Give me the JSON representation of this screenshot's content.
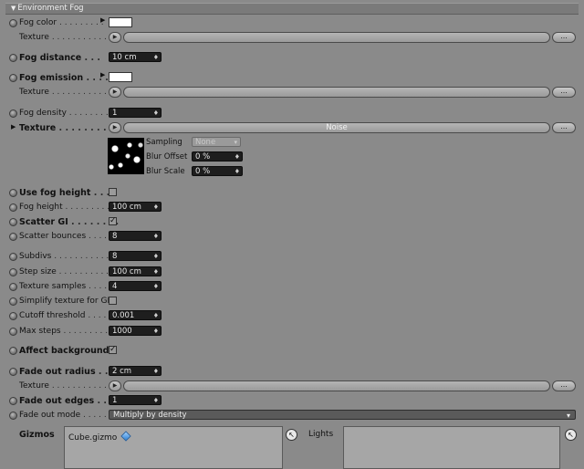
{
  "section": {
    "title": "Environment Fog"
  },
  "rows": {
    "fog_color": {
      "label": "Fog color",
      "dots": " . . . . . . . . ."
    },
    "texture1": {
      "label": "Texture",
      "dots": " . . . . . . . . . . . ."
    },
    "fog_distance": {
      "label": "Fog distance",
      "dots": " . . .",
      "value": "10 cm"
    },
    "fog_emission": {
      "label": "Fog emission",
      "dots": " . . . ."
    },
    "texture2": {
      "label": "Texture",
      "dots": " . . . . . . . . . . . ."
    },
    "fog_density": {
      "label": "Fog density",
      "dots": " . . . . . . . . .",
      "value": "1"
    },
    "texture3": {
      "label": "Texture",
      "dots": " . . . . . . . . .",
      "field": "Noise"
    },
    "use_fog_height": {
      "label": "Use fog height",
      "dots": " . . ."
    },
    "fog_height": {
      "label": "Fog height",
      "dots": " . . . . . . . . .",
      "value": "100 cm"
    },
    "scatter_gi": {
      "label": "Scatter GI",
      "dots": " . . . . . . . ."
    },
    "scatter_bounces": {
      "label": "Scatter bounces",
      "dots": " . . . . .",
      "value": "8"
    },
    "subdivs": {
      "label": "Subdivs",
      "dots": " . . . . . . . . . . . . .",
      "value": "8"
    },
    "step_size": {
      "label": "Step size",
      "dots": " . . . . . . . . . . .",
      "value": "100 cm"
    },
    "texture_samples": {
      "label": "Texture samples",
      "dots": " . . . .",
      "value": "4"
    },
    "simplify_texture": {
      "label": "Simplify texture for GI",
      "dots": ""
    },
    "cutoff_threshold": {
      "label": "Cutoff threshold",
      "dots": " . . . .",
      "value": "0.001"
    },
    "max_steps": {
      "label": "Max steps",
      "dots": " . . . . . . . . . .",
      "value": "1000"
    },
    "affect_background": {
      "label": "Affect background",
      "dots": ""
    },
    "fade_out_radius": {
      "label": "Fade out radius",
      "dots": " . .",
      "value": "2 cm"
    },
    "texture4": {
      "label": "Texture",
      "dots": " . . . . . . . . . . . ."
    },
    "fade_out_edges": {
      "label": "Fade out edges",
      "dots": " . . .",
      "value": "1"
    },
    "fade_out_mode": {
      "label": "Fade out mode",
      "dots": " . . . . . .",
      "value": "Multiply by density"
    }
  },
  "noise": {
    "sampling_label": "Sampling",
    "sampling_value": "None",
    "blur_offset_label": "Blur Offset",
    "blur_offset_value": "0 %",
    "blur_scale_label": "Blur Scale",
    "blur_scale_value": "0 %"
  },
  "tex_btn": "...",
  "gizmos": {
    "label": "Gizmos",
    "items": [
      "Cube.gizmo"
    ]
  },
  "lights": {
    "label": "Lights"
  },
  "colors": {
    "fog_color": "#ffffff",
    "fog_emission": "#ffffff",
    "background": "#8a8a8a"
  }
}
